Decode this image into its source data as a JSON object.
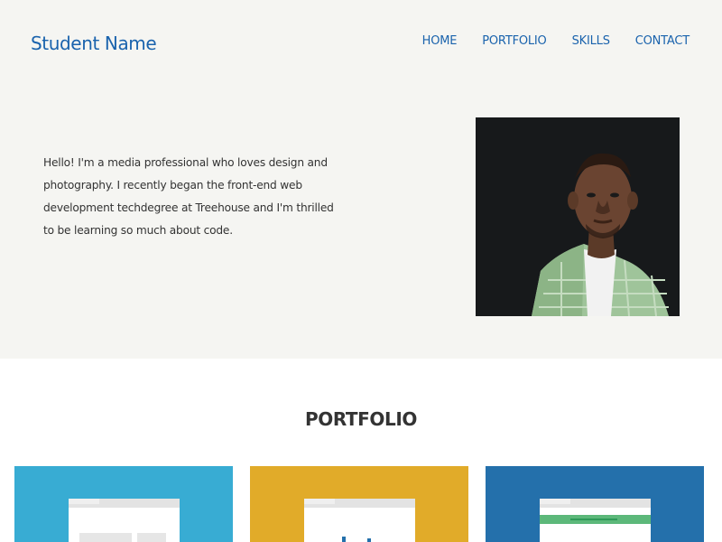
{
  "header": {
    "brand": "Student Name",
    "nav": [
      "HOME",
      "PORTFOLIO",
      "SKILLS",
      "CONTACT"
    ]
  },
  "intro": {
    "text": "Hello! I'm a media professional who loves design and photography. I recently began the front-end web development techdegree at Treehouse and I'm thrilled to be learning so much about code."
  },
  "portfolio": {
    "title": "PORTFOLIO"
  },
  "colors": {
    "brand": "#1a63ad",
    "hero_bg": "#f5f5f2",
    "card_1": "#38acd3",
    "card_2": "#e1ab29",
    "card_3": "#2470ab",
    "green_accent": "#5cb87a"
  }
}
